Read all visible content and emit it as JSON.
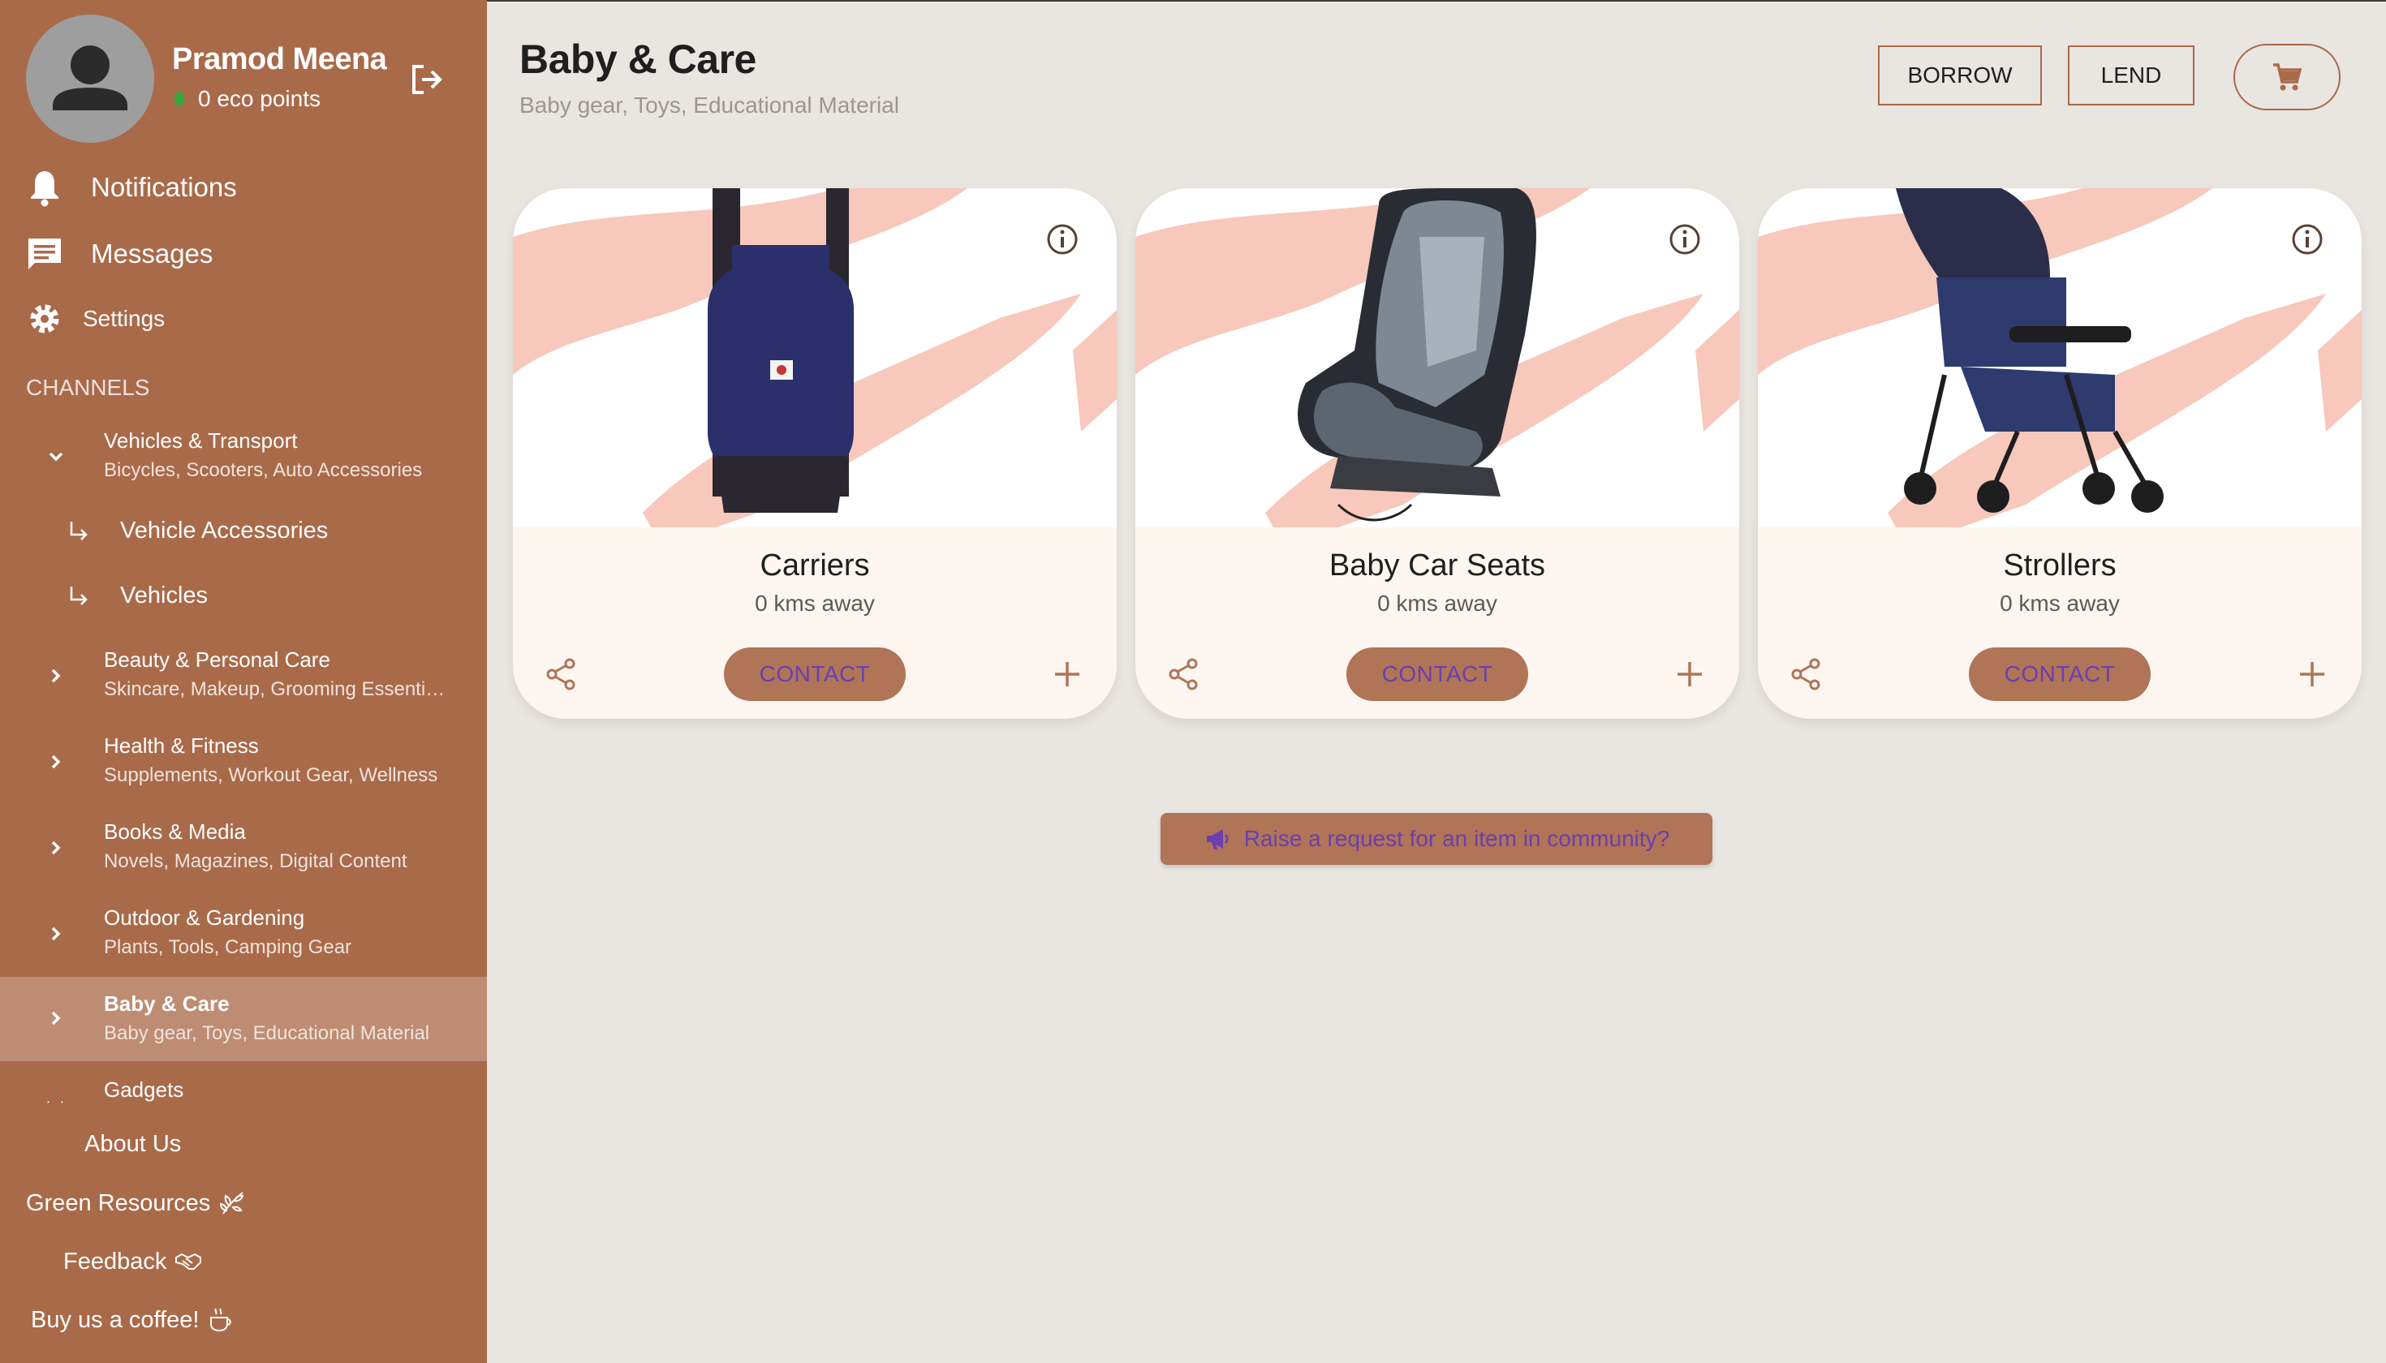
{
  "user": {
    "name": "Pramod Meena",
    "eco_points": "0 eco points"
  },
  "nav": {
    "notifications": "Notifications",
    "messages": "Messages",
    "settings": "Settings"
  },
  "channels": {
    "heading": "CHANNELS",
    "categories": [
      {
        "title": "Vehicles & Transport",
        "subtitle": "Bicycles, Scooters, Auto Accessories",
        "expanded": true
      },
      {
        "title": "Beauty & Personal Care",
        "subtitle": "Skincare, Makeup, Grooming Essentials"
      },
      {
        "title": "Health & Fitness",
        "subtitle": "Supplements, Workout Gear, Wellness"
      },
      {
        "title": "Books & Media",
        "subtitle": "Novels, Magazines, Digital Content"
      },
      {
        "title": "Outdoor & Gardening",
        "subtitle": "Plants, Tools, Camping Gear"
      },
      {
        "title": "Baby & Care",
        "subtitle": "Baby gear, Toys, Educational Material",
        "active": true
      },
      {
        "title": "Gadgets",
        "subtitle": ""
      }
    ],
    "subitems": [
      "Vehicle Accessories",
      "Vehicles"
    ]
  },
  "footer_links": {
    "about": "About Us",
    "green": "Green Resources",
    "feedback": "Feedback",
    "coffee": "Buy us a coffee!"
  },
  "header": {
    "title": "Baby & Care",
    "subtitle": "Baby gear, Toys, Educational Material",
    "borrow": "BORROW",
    "lend": "LEND"
  },
  "products": [
    {
      "name": "Carriers",
      "distance": "0 kms away",
      "contact": "CONTACT"
    },
    {
      "name": "Baby Car Seats",
      "distance": "0 kms away",
      "contact": "CONTACT"
    },
    {
      "name": "Strollers",
      "distance": "0 kms away",
      "contact": "CONTACT"
    }
  ],
  "raise_request": "Raise a request for an item in community?",
  "colors": {
    "sidebar": "#a96a4a",
    "accent": "#b07457",
    "background": "#e9e5e1",
    "link_purple": "#6a3fb0"
  }
}
